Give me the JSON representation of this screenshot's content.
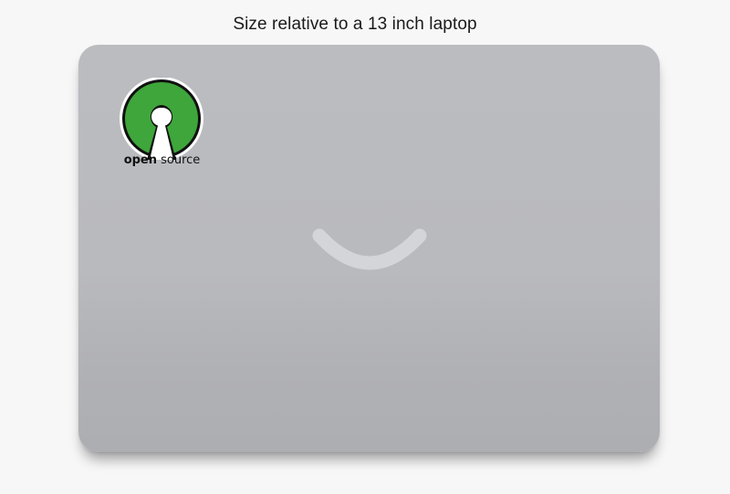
{
  "caption": "Size relative to a 13 inch laptop",
  "sticker": {
    "word_bold": "open",
    "word_regular": " source",
    "icon": "open-source-keyhole-logo",
    "color": "#3ea63a"
  },
  "colors": {
    "laptop_body": "#b9babe",
    "smile_logo": "#d3d5d9",
    "background": "#f7f7f7"
  }
}
